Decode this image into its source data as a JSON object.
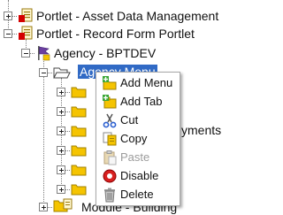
{
  "tree": {
    "nodes": {
      "asset_portlet": "Portlet - Asset Data Management",
      "record_form_portlet": "Portlet - Record Form Portlet",
      "agency": "Agency - BPTDEV",
      "agency_menu": "Agency Menu",
      "payments_fragment": "yments",
      "module_building": "Module - Building"
    }
  },
  "context_menu": {
    "items": [
      {
        "label": "Add Menu",
        "icon": "add-menu-icon",
        "enabled": true
      },
      {
        "label": "Add Tab",
        "icon": "add-tab-icon",
        "enabled": true
      },
      {
        "label": "Cut",
        "icon": "scissors-icon",
        "enabled": true
      },
      {
        "label": "Copy",
        "icon": "copy-icon",
        "enabled": true
      },
      {
        "label": "Paste",
        "icon": "paste-icon",
        "enabled": false
      },
      {
        "label": "Disable",
        "icon": "disable-icon",
        "enabled": true
      },
      {
        "label": "Delete",
        "icon": "trash-icon",
        "enabled": true
      }
    ]
  },
  "colors": {
    "selection": "#316ac5",
    "folder": "#f5c400",
    "portlet_icon_red": "#d40000",
    "agency_icon": "#6b3fa0"
  }
}
